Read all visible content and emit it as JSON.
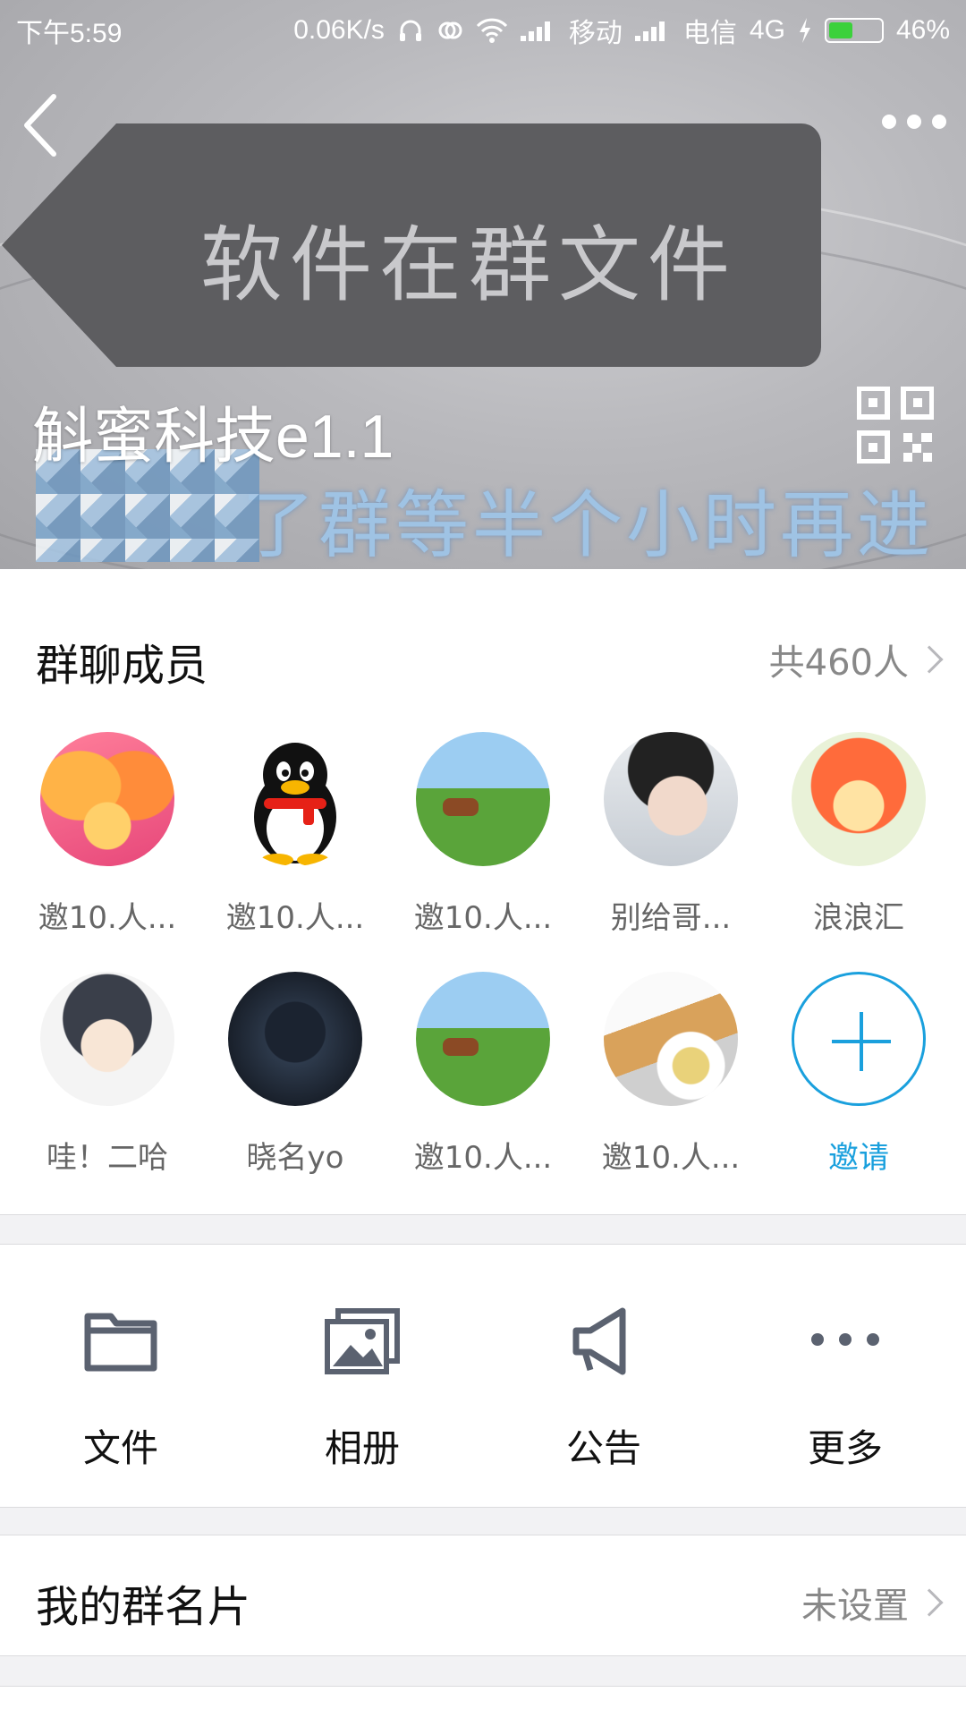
{
  "status_bar": {
    "time": "下午5:59",
    "speed": "0.06K/s",
    "carrier1": "移动",
    "carrier2": "电信",
    "network": "4G",
    "battery": "46%",
    "battery_level": 0.46
  },
  "cover": {
    "tag_text": "软件在群文件",
    "banner_text": "了群等半个小时再进",
    "group_name": "斛蜜科技e1.1",
    "back_icon": "back-chevron-icon",
    "more_icon": "more-dots-icon",
    "qr_icon": "qr-code-icon"
  },
  "members": {
    "title": "群聊成员",
    "count": "共460人",
    "list": [
      {
        "name": "邀10.人...",
        "avatar": "flower"
      },
      {
        "name": "邀10.人...",
        "avatar": "penguin"
      },
      {
        "name": "邀10.人...",
        "avatar": "field"
      },
      {
        "name": "别给哥...",
        "avatar": "boy"
      },
      {
        "name": "浪浪汇",
        "avatar": "cartoon"
      },
      {
        "name": "哇！二哈",
        "avatar": "anime"
      },
      {
        "name": "晓名yo",
        "avatar": "dark"
      },
      {
        "name": "邀10.人...",
        "avatar": "field"
      },
      {
        "name": "邀10.人...",
        "avatar": "tea"
      },
      {
        "name": "邀请",
        "avatar": "invite-plus"
      }
    ]
  },
  "actions": [
    {
      "label": "文件",
      "icon": "folder-icon"
    },
    {
      "label": "相册",
      "icon": "photo-album-icon"
    },
    {
      "label": "公告",
      "icon": "megaphone-icon"
    },
    {
      "label": "更多",
      "icon": "more-icon"
    }
  ],
  "group_card": {
    "label": "我的群名片",
    "value": "未设置"
  },
  "colors": {
    "accent": "#1aa0dd",
    "icon_gray": "#5b6270",
    "battery_green": "#3bd13b"
  }
}
